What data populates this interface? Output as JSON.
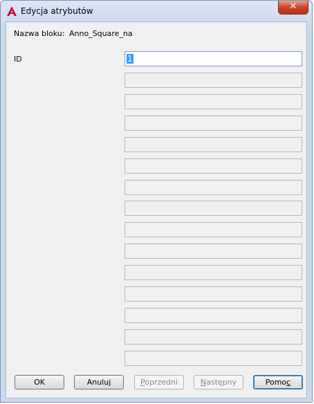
{
  "window": {
    "title": "Edycja atrybutów",
    "close_symbol": "✕",
    "app_icon": "autocad-a-icon"
  },
  "block": {
    "label": "Nazwa bloku:",
    "value": "Anno_Square_na"
  },
  "attributes": [
    {
      "label": "ID",
      "value": "1"
    },
    {
      "label": "",
      "value": ""
    },
    {
      "label": "",
      "value": ""
    },
    {
      "label": "",
      "value": ""
    },
    {
      "label": "",
      "value": ""
    },
    {
      "label": "",
      "value": ""
    },
    {
      "label": "",
      "value": ""
    },
    {
      "label": "",
      "value": ""
    },
    {
      "label": "",
      "value": ""
    },
    {
      "label": "",
      "value": ""
    },
    {
      "label": "",
      "value": ""
    },
    {
      "label": "",
      "value": ""
    },
    {
      "label": "",
      "value": ""
    },
    {
      "label": "",
      "value": ""
    },
    {
      "label": "",
      "value": ""
    }
  ],
  "buttons": {
    "ok": "OK",
    "cancel": "Anuluj",
    "prev_a": "P",
    "prev_b": "oprzedni",
    "next_a": "N",
    "next_b": "astępny",
    "help_a": "Pomo",
    "help_b": "c"
  }
}
